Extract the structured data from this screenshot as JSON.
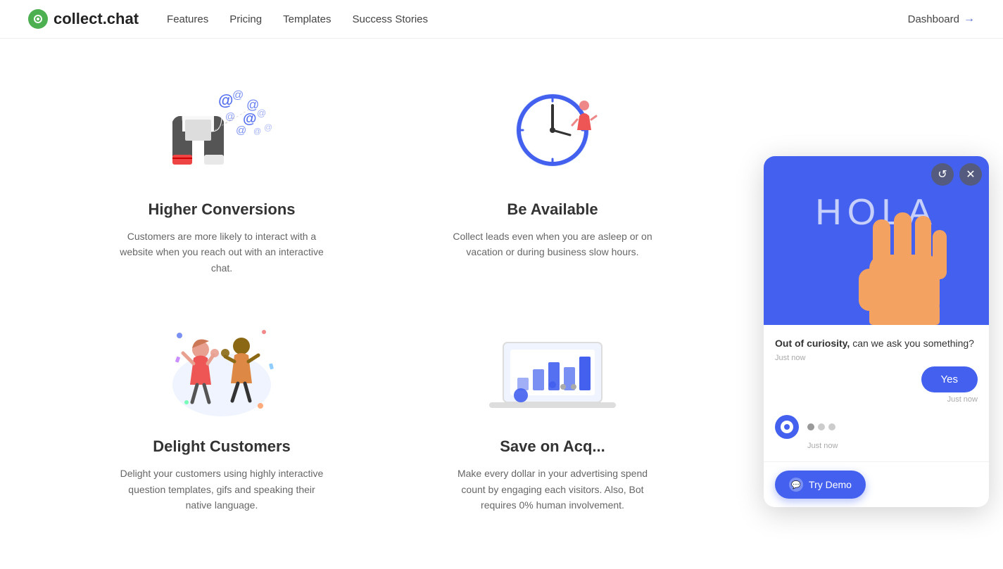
{
  "navbar": {
    "brand_name": "collect.chat",
    "links": [
      {
        "label": "Features",
        "href": "#"
      },
      {
        "label": "Pricing",
        "href": "#"
      },
      {
        "label": "Templates",
        "href": "#"
      },
      {
        "label": "Success Stories",
        "href": "#"
      }
    ],
    "dashboard_label": "Dashboard"
  },
  "features": [
    {
      "id": "higher-conversions",
      "title": "Higher Conversions",
      "desc": "Customers are more likely to interact with a website when you reach out with an interactive chat."
    },
    {
      "id": "be-available",
      "title": "Be Available",
      "desc": "Collect leads even when a... are asleep or on vacatio... business sl..."
    },
    {
      "id": "delight-customers",
      "title": "Delight Customers",
      "desc": "Delight your customers using highly interactive question templates, gifs and speaking their native language."
    },
    {
      "id": "save-on-acq",
      "title": "Save on Acq...",
      "desc": "Make every dollar in your advertising spend count by engaging each visitors. Also, Bot requires 0% human involvement."
    }
  ],
  "chat_widget": {
    "hola_text": "HOLA",
    "bot_message": "Out of curiosity,",
    "bot_message_rest": " can we ask you something?",
    "bot_timestamp": "Just now",
    "yes_button": "Yes",
    "yes_timestamp": "Just now",
    "typing_timestamp": "Just now",
    "try_demo_label": "Try Demo",
    "refresh_icon": "↺",
    "close_icon": "✕"
  }
}
